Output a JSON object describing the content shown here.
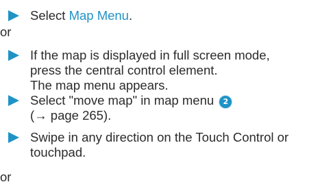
{
  "steps": [
    {
      "prefix": "Select ",
      "link": "Map Menu",
      "suffix": "."
    },
    {
      "lines": [
        "If the map is displayed in full screen mode,",
        "press the central control element.",
        "The map menu appears."
      ]
    },
    {
      "line1_text": "Select \"move map\" in map menu ",
      "badge": "2",
      "line2": "(→ page 265)."
    },
    {
      "lines": [
        "Swipe in any direction on the Touch Control or",
        "touchpad."
      ]
    }
  ],
  "or_label": "or",
  "colors": {
    "accent": "#1f93c6",
    "text": "#2b2b2b"
  }
}
